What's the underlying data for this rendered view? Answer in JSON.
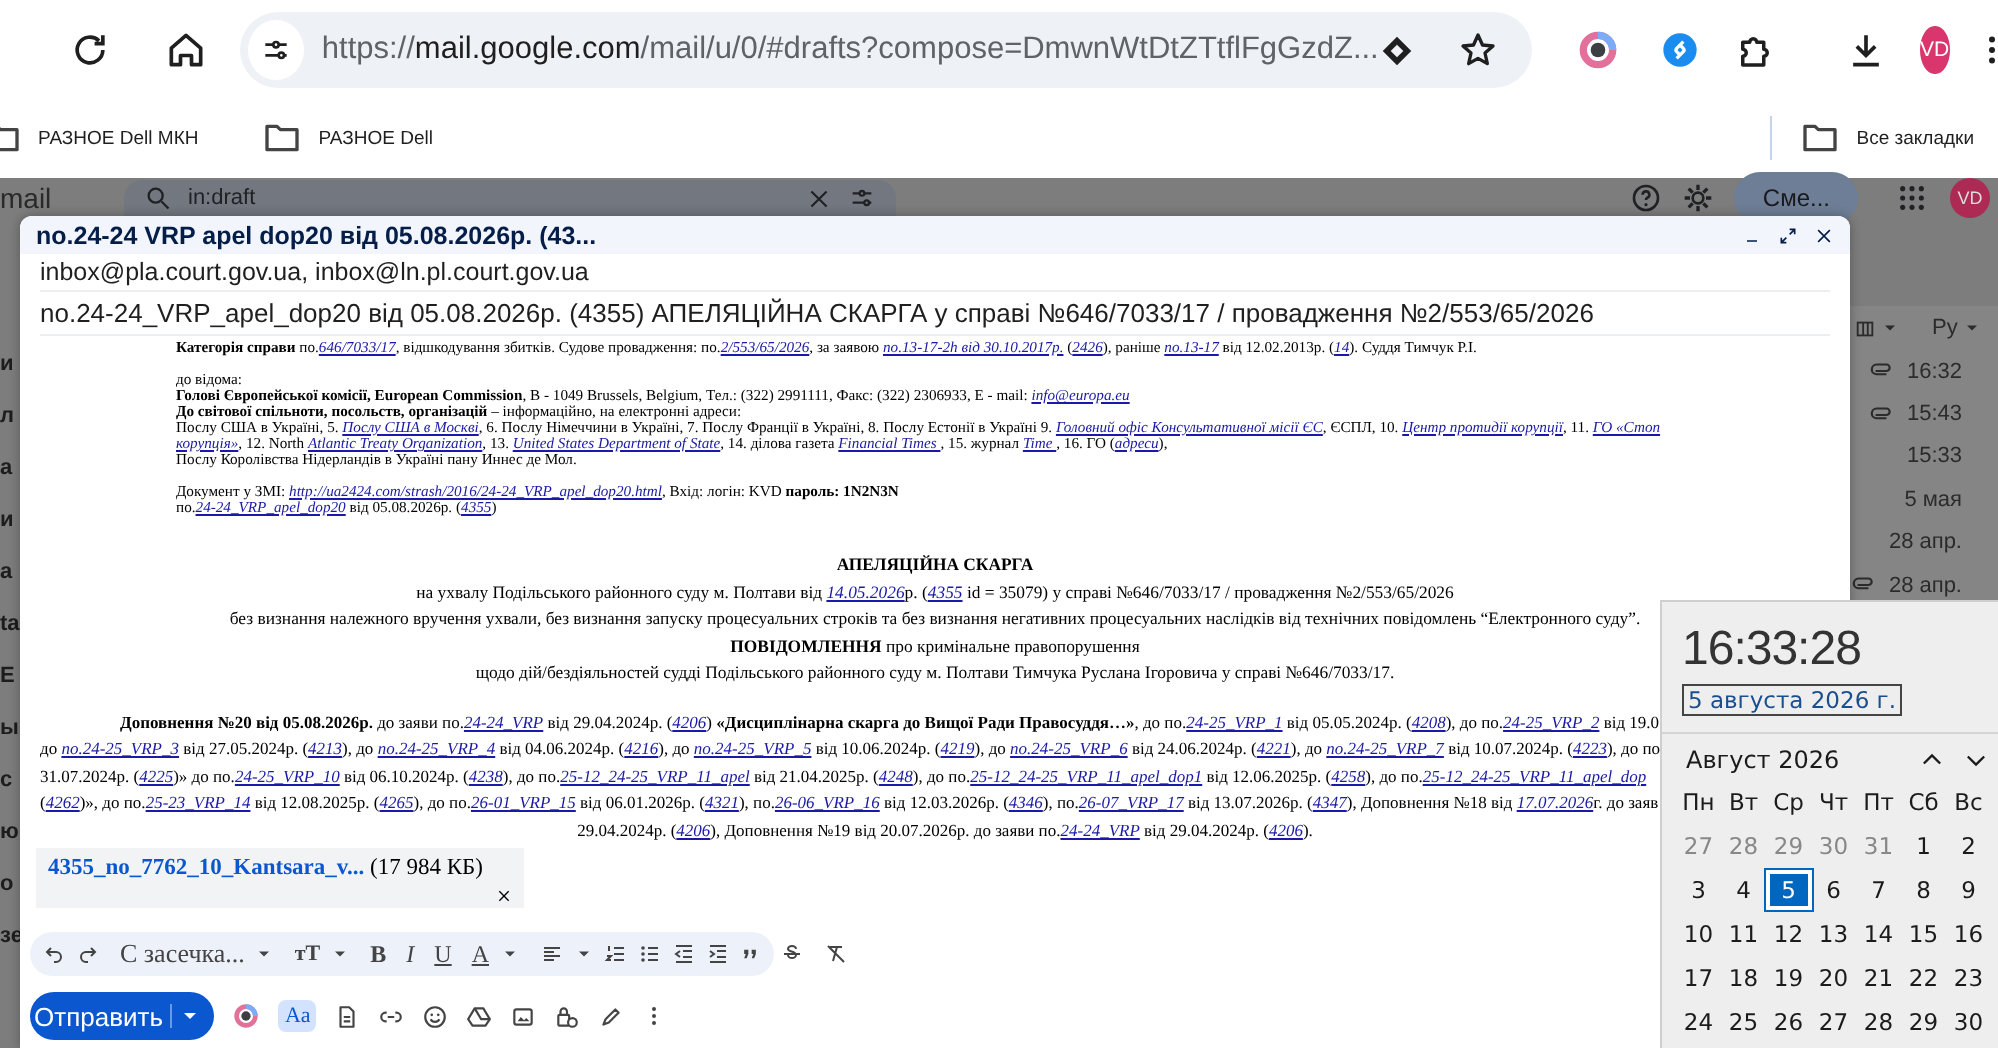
{
  "browser": {
    "url": {
      "scheme": "https://",
      "host": "mail.google.com",
      "path": "/mail/u/0/#drafts?compose=DmwnWtDtZTtflFgGzdZ..."
    },
    "profile_initials": "VD",
    "bookmarks": [
      {
        "label": "РАЗНОЕ Dell МКН"
      },
      {
        "label": "РАЗНОЕ Dell"
      }
    ],
    "all_bookmarks": "Все закладки"
  },
  "gmail": {
    "app_name_fragment": "mail",
    "search": {
      "value": "in:draft"
    },
    "action_button": "Сме...",
    "avatar": "VD",
    "left_fragments": [
      "и",
      "л",
      "а",
      "и",
      "а",
      "ta",
      "E",
      "ы",
      "с",
      "ю",
      "о",
      "зе"
    ],
    "list_header": {
      "sort_label": "Ру"
    },
    "rows": [
      {
        "time": "16:32",
        "attachment": true
      },
      {
        "time": "15:43",
        "attachment": true
      },
      {
        "time": "15:33",
        "attachment": false
      },
      {
        "time": "5 мая",
        "attachment": false
      },
      {
        "time": "28 апр.",
        "attachment": false
      },
      {
        "time": "28 апр.",
        "attachment": true
      }
    ]
  },
  "compose": {
    "title": "no.24-24 VRP apel dop20 від 05.08.2026р. (43...",
    "recipients": "inbox@pla.court.gov.ua, inbox@ln.pl.court.gov.ua",
    "subject": "no.24-24_VRP_apel_dop20 від 05.08.2026р. (4355) АПЕЛЯЦІЙНА СКАРГА у справі №646/7033/17 / провадження №2/553/65/2026",
    "document": [
      {
        "kind": "notice",
        "lines": [
          [
            "**Категорія справи** по.",
            {
              "link": "646/7033/17"
            },
            ", відшкодування збитків. Судове провадження: по.",
            {
              "link": "2/553/65/2026"
            },
            ", за заявою ",
            {
              "link": "по.13-17-2h від 30.10.2017р."
            },
            " (",
            {
              "link": "2426"
            },
            "), раніше ",
            {
              "link": "по.13-17"
            },
            " від 12.02.2013р. (",
            {
              "link": "14"
            },
            "). Суддя Тимчук Р.І."
          ]
        ]
      },
      {
        "kind": "notice",
        "lines": [
          [
            "до відома:"
          ],
          [
            "**Голові Європейської комісії, European Commission**, B - 1049 Brussels, Belgium, Тел.: (322) 2991111, Факс: (322) 2306933, E - mail: ",
            {
              "link": "info@europa.eu"
            }
          ],
          [
            "**До світової спільноти, посольств, організацій** – інформаційно, на електронні адреси:"
          ],
          [
            "Послу США в Україні, 5. ",
            {
              "link": "Послу США в Москві"
            },
            ", 6. Послу Німеччини в Україні, 7. Послу Франції в Україні, 8. Послу Естонії в Україні 9. ",
            {
              "link": "Головний офіс Консультативної місії ЄС"
            },
            ", ЄСПЛ, 10. ",
            {
              "link": "Центр протидії корупції"
            },
            ", 11. ",
            {
              "link": "ГО «Стоп"
            }
          ],
          [
            {
              "link": "корупція»"
            },
            ", 12. North ",
            {
              "link": "Atlantic Treaty Organization"
            },
            ", 13. ",
            {
              "link": "United States Department of State"
            },
            ", 14. ділова газета ",
            {
              "link": "Financial Times "
            },
            ", 15. журнал ",
            {
              "link": "Time "
            },
            ", 16. ГО (",
            {
              "link": "адреси"
            },
            "),"
          ],
          [
            "Послу Королівства Нідерландів в Україні пану Иннес де Мол."
          ]
        ]
      },
      {
        "kind": "notice",
        "lines": [
          [
            "Документ у ЗМІ: ",
            {
              "link": "http://ua2424.com/strash/2016/24-24_VRP_apel_dop20.html"
            },
            ", Вхід: логін: KVD **пароль: 1N2N3N**"
          ],
          [
            "по.",
            {
              "link": "24-24_VRP_apel_dop20"
            },
            " від 05.08.2026р. (",
            {
              "link": "4355"
            },
            ")"
          ]
        ]
      },
      {
        "kind": "heading",
        "lines": [
          [
            "**АПЕЛЯЦІЙНА СКАРГА**"
          ],
          [
            "на ухвалу Подільського районного суду м. Полтави від ",
            {
              "link": "14.05.2026"
            },
            "р. (",
            {
              "link": "4355"
            },
            " id = 35079) у справі №646/7033/17 / провадження №2/553/65/2026"
          ],
          [
            "без визнання належного вручення ухвали, без визнання запуску процесуальних строків та без визнання негативних процесуальних наслідків від технічних повідомлень “Електронного суду”."
          ],
          [
            "**ПОВІДОМЛЕННЯ** про кримінальне правопорушення"
          ],
          [
            "щодо дій/бездіяльностей судді Подільського районного суду м. Полтави Тимчука Руслана Ігоровича у справі №646/7033/17."
          ]
        ]
      },
      {
        "kind": "addendum",
        "lines": [
          [
            "**Доповнення №20 від 05.08.2026р.** до заяви по.",
            {
              "link": "24-24_VRP"
            },
            " від 29.04.2024р. (",
            {
              "link": "4206"
            },
            ") **«Дисциплінарна скарга до Вищої Ради Правосуддя…»**, до по.",
            {
              "link": "24-25_VRP_1"
            },
            " від 05.05.2024р. (",
            {
              "link": "4208"
            },
            "), до по.",
            {
              "link": "24-25_VRP_2"
            },
            " від 19.0"
          ],
          [
            "до ",
            {
              "link": "по.24-25_VRP_3"
            },
            " від 27.05.2024р. (",
            {
              "link": "4213"
            },
            "), до ",
            {
              "link": "по.24-25_VRP_4"
            },
            " від 04.06.2024р. (",
            {
              "link": "4216"
            },
            "), до ",
            {
              "link": "по.24-25_VRP_5"
            },
            " від 10.06.2024р. (",
            {
              "link": "4219"
            },
            "), до ",
            {
              "link": "по.24-25_VRP_6"
            },
            " від 24.06.2024р. (",
            {
              "link": "4221"
            },
            "), до ",
            {
              "link": "по.24-25_VRP_7"
            },
            " від 10.07.2024р. (",
            {
              "link": "4223"
            },
            "), до по."
          ],
          [
            "31.07.2024р. (",
            {
              "link": "4225"
            },
            ")» до по.",
            {
              "link": "24-25_VRP_10"
            },
            " від 06.10.2024р. (",
            {
              "link": "4238"
            },
            "), до по.",
            {
              "link": "25-12_24-25_VRP_11_apel"
            },
            " від 21.04.2025р. (",
            {
              "link": "4248"
            },
            "), до по.",
            {
              "link": "25-12_24-25_VRP_11_apel_dop1"
            },
            " від 12.06.2025р. (",
            {
              "link": "4258"
            },
            "), до по.",
            {
              "link": "25-12_24-25_VRP_11_apel_dop"
            }
          ],
          [
            "(",
            {
              "link": "4262"
            },
            ")», до по.",
            {
              "link": "25-23_VRP_14"
            },
            " від 12.08.2025р. (",
            {
              "link": "4265"
            },
            "), до по.",
            {
              "link": "26-01_VRP_15"
            },
            " від 06.01.2026р. (",
            {
              "link": "4321"
            },
            "), по.",
            {
              "link": "26-06_VRP_16"
            },
            " від 12.03.2026р. (",
            {
              "link": "4346"
            },
            "), по.",
            {
              "link": "26-07_VRP_17"
            },
            " від 13.07.2026р. (",
            {
              "link": "4347"
            },
            "), Доповнення №18 від ",
            {
              "link": "17.07.2026"
            },
            "г. до заяв"
          ],
          [
            "29.04.2024р. (",
            {
              "link": "4206"
            },
            "), Доповнення №19 від 20.07.2026р. до заяви по.",
            {
              "link": "24-24_VRP"
            },
            " від 29.04.2024р. (",
            {
              "link": "4206"
            },
            ")."
          ]
        ]
      }
    ],
    "attachment": {
      "name": "4355_no_7762_10_Kantsara_v...",
      "size": "(17 984 КБ)"
    },
    "format_toolbar": {
      "font": "С засечка...",
      "size_glyph": "тТ",
      "bold": "B",
      "italic": "I",
      "underline": "U",
      "text_color_glyph": "A"
    },
    "send_label": "Отправить",
    "formatting_toggle": {
      "label": "Aa",
      "on": true
    }
  },
  "clock": {
    "time": "16:33:28",
    "date": "5 августа 2026 г.",
    "month": "Август 2026",
    "weekdays": [
      "Пн",
      "Вт",
      "Ср",
      "Чт",
      "Пт",
      "Сб",
      "Вс"
    ],
    "weeks": [
      [
        {
          "day": "27",
          "outside_month": true,
          "selected": false
        },
        {
          "day": "28",
          "outside_month": true,
          "selected": false
        },
        {
          "day": "29",
          "outside_month": true,
          "selected": false
        },
        {
          "day": "30",
          "outside_month": true,
          "selected": false
        },
        {
          "day": "31",
          "outside_month": true,
          "selected": false
        },
        {
          "day": "1",
          "outside_month": false,
          "selected": false
        },
        {
          "day": "2",
          "outside_month": false,
          "selected": false
        }
      ],
      [
        {
          "day": "3",
          "outside_month": false,
          "selected": false
        },
        {
          "day": "4",
          "outside_month": false,
          "selected": false
        },
        {
          "day": "5",
          "outside_month": false,
          "selected": true
        },
        {
          "day": "6",
          "outside_month": false,
          "selected": false
        },
        {
          "day": "7",
          "outside_month": false,
          "selected": false
        },
        {
          "day": "8",
          "outside_month": false,
          "selected": false
        },
        {
          "day": "9",
          "outside_month": false,
          "selected": false
        }
      ],
      [
        {
          "day": "10",
          "outside_month": false,
          "selected": false
        },
        {
          "day": "11",
          "outside_month": false,
          "selected": false
        },
        {
          "day": "12",
          "outside_month": false,
          "selected": false
        },
        {
          "day": "13",
          "outside_month": false,
          "selected": false
        },
        {
          "day": "14",
          "outside_month": false,
          "selected": false
        },
        {
          "day": "15",
          "outside_month": false,
          "selected": false
        },
        {
          "day": "16",
          "outside_month": false,
          "selected": false
        }
      ],
      [
        {
          "day": "17",
          "outside_month": false,
          "selected": false
        },
        {
          "day": "18",
          "outside_month": false,
          "selected": false
        },
        {
          "day": "19",
          "outside_month": false,
          "selected": false
        },
        {
          "day": "20",
          "outside_month": false,
          "selected": false
        },
        {
          "day": "21",
          "outside_month": false,
          "selected": false
        },
        {
          "day": "22",
          "outside_month": false,
          "selected": false
        },
        {
          "day": "23",
          "outside_month": false,
          "selected": false
        }
      ],
      [
        {
          "day": "24",
          "outside_month": false,
          "selected": false
        },
        {
          "day": "25",
          "outside_month": false,
          "selected": false
        },
        {
          "day": "26",
          "outside_month": false,
          "selected": false
        },
        {
          "day": "27",
          "outside_month": false,
          "selected": false
        },
        {
          "day": "28",
          "outside_month": false,
          "selected": false
        },
        {
          "day": "29",
          "outside_month": false,
          "selected": false
        },
        {
          "day": "30",
          "outside_month": false,
          "selected": false
        }
      ]
    ]
  }
}
